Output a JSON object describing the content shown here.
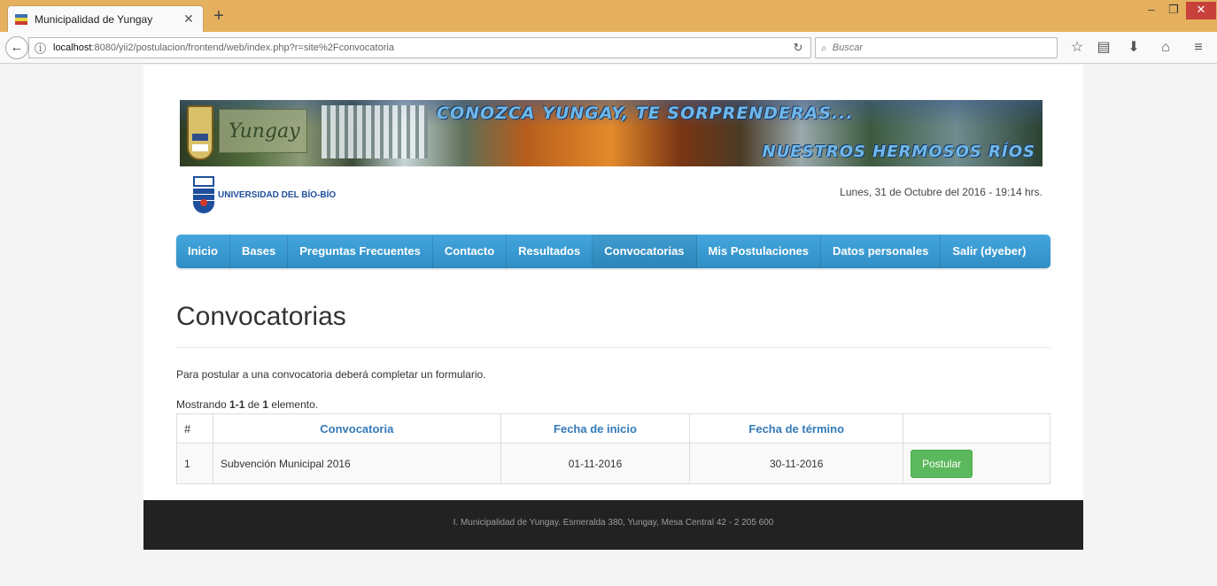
{
  "browser": {
    "tab_title": "Municipalidad de Yungay",
    "url_host": "localhost",
    "url_rest": ":8080/yii2/postulacion/frontend/web/index.php?r=site%2Fconvocatoria",
    "search_placeholder": "Buscar"
  },
  "header": {
    "banner_slogan": "CONOZCA YUNGAY, TE SORPRENDERAS...",
    "banner_subslogan": "NUESTROS HERMOSOS RÍOS",
    "banner_logo_text": "Yungay",
    "university": "UNIVERSIDAD DEL BÍO-BÍO",
    "date": "Lunes, 31 de Octubre del 2016 - 19:14 hrs."
  },
  "nav": [
    {
      "label": "Inicio"
    },
    {
      "label": "Bases"
    },
    {
      "label": "Preguntas Frecuentes"
    },
    {
      "label": "Contacto"
    },
    {
      "label": "Resultados"
    },
    {
      "label": "Convocatorias"
    },
    {
      "label": "Mis Postulaciones"
    },
    {
      "label": "Datos personales"
    },
    {
      "label": "Salir (dyeber)"
    }
  ],
  "main": {
    "title": "Convocatorias",
    "intro": "Para postular a una convocatoria deberá completar un formulario.",
    "summary_prefix": "Mostrando ",
    "summary_range": "1-1",
    "summary_mid": " de ",
    "summary_total": "1",
    "summary_suffix": " elemento."
  },
  "table": {
    "headers": [
      "#",
      "Convocatoria",
      "Fecha de inicio",
      "Fecha de término",
      ""
    ],
    "rows": [
      {
        "num": "1",
        "name": "Subvención Municipal 2016",
        "start": "01-11-2016",
        "end": "30-11-2016",
        "action": "Postular"
      }
    ]
  },
  "footer": {
    "text": "I. Municipalidad de Yungay. Esmeralda 380, Yungay, Mesa Central 42 - 2 205 600"
  },
  "colors": {
    "nav_blue": "#3399d4",
    "button_green": "#5cb85c",
    "footer_bg": "#222222"
  }
}
